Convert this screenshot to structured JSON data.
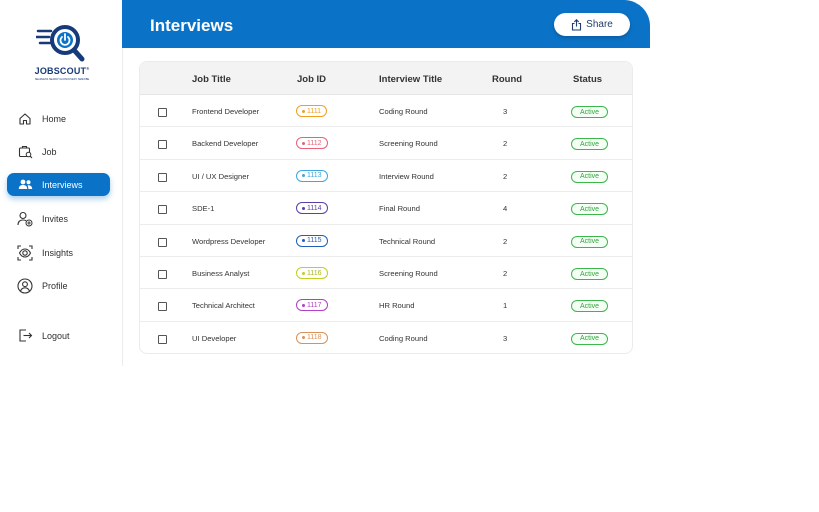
{
  "brand": {
    "name": "JOBSCOUT",
    "tagline": "SEAMLESS SEARCH & DISCOVERY SEMOIBE",
    "primary_color": "#0b73c7"
  },
  "sidebar": {
    "items": [
      {
        "label": "Home",
        "icon": "home-icon",
        "active": false
      },
      {
        "label": "Job",
        "icon": "job-icon",
        "active": false
      },
      {
        "label": "Interviews",
        "icon": "users-icon",
        "active": true
      },
      {
        "label": "Invites",
        "icon": "invite-user-icon",
        "active": false
      },
      {
        "label": "Insights",
        "icon": "insights-eye-icon",
        "active": false
      },
      {
        "label": "Profile",
        "icon": "profile-icon",
        "active": false
      }
    ],
    "logout_label": "Logout"
  },
  "header": {
    "title": "Interviews",
    "share_label": "Share"
  },
  "table": {
    "columns": [
      "Job Title",
      "Job ID",
      "Interview Title",
      "Round",
      "Status"
    ],
    "rows": [
      {
        "job_title": "Frontend Developer",
        "job_id": "1111",
        "id_color": "#f0a020",
        "interview_title": "Coding Round",
        "round": "3",
        "status": "Active"
      },
      {
        "job_title": "Backend Developer",
        "job_id": "1112",
        "id_color": "#e8607a",
        "interview_title": "Screening Round",
        "round": "2",
        "status": "Active"
      },
      {
        "job_title": "UI / UX Designer",
        "job_id": "1113",
        "id_color": "#3fa6e0",
        "interview_title": "Interview Round",
        "round": "2",
        "status": "Active"
      },
      {
        "job_title": "SDE-1",
        "job_id": "1114",
        "id_color": "#5a3fa8",
        "interview_title": "Final Round",
        "round": "4",
        "status": "Active"
      },
      {
        "job_title": "Wordpress Developer",
        "job_id": "1115",
        "id_color": "#1f5fb8",
        "interview_title": "Technical Round",
        "round": "2",
        "status": "Active"
      },
      {
        "job_title": "Business Analyst",
        "job_id": "1116",
        "id_color": "#c2cf20",
        "interview_title": "Screening Round",
        "round": "2",
        "status": "Active"
      },
      {
        "job_title": "Technical Architect",
        "job_id": "1117",
        "id_color": "#b23fc6",
        "interview_title": "HR Round",
        "round": "1",
        "status": "Active"
      },
      {
        "job_title": "UI Developer",
        "job_id": "1118",
        "id_color": "#d8925a",
        "interview_title": "Coding Round",
        "round": "3",
        "status": "Active"
      }
    ]
  }
}
